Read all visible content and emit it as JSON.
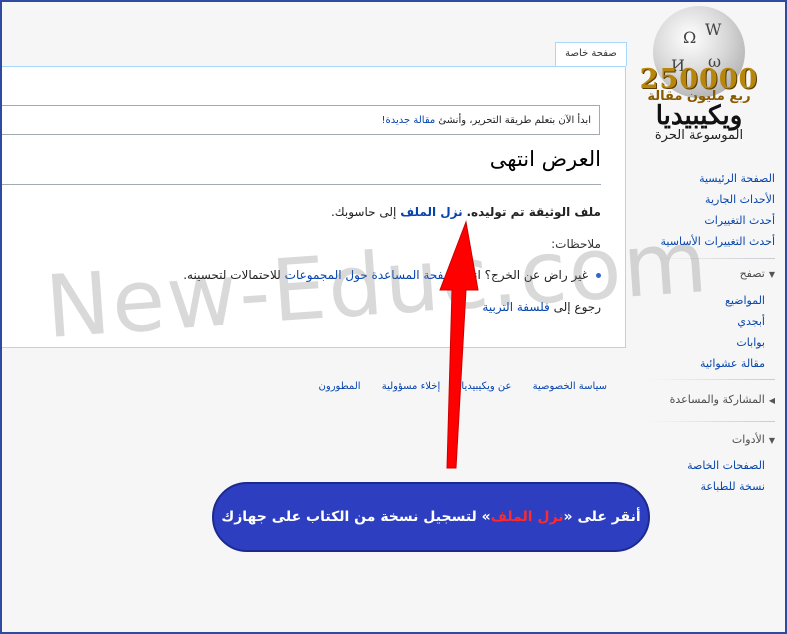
{
  "logo": {
    "count": "250000",
    "subtitle_count": "ربع مليون مقالة",
    "name": "ويكيبيديا",
    "tagline": "الموسوعة الحرة"
  },
  "sidebar": {
    "main_links": [
      "الصفحة الرئيسية",
      "الأحداث الجارية",
      "أحدث التغييرات",
      "أحدث التغييرات الأساسية"
    ],
    "browse": {
      "label": "تصفح",
      "items": [
        "المواضيع",
        "أبجدي",
        "بوابات",
        "مقالة عشوائية"
      ]
    },
    "participate": {
      "label": "المشاركة والمساعدة"
    },
    "tools": {
      "label": "الأدوات",
      "items": [
        "الصفحات الخاصة",
        "نسخة للطباعة"
      ]
    }
  },
  "tab": {
    "label": "صفحة خاصة"
  },
  "notice": {
    "text": "ابدأ الآن بتعلم طريقة التحرير، وأنشئ",
    "link": "مقالة جديدة!"
  },
  "page": {
    "title": "العرض انتهى",
    "generated_bold": "ملف الوثيقة تم توليده.",
    "download_link": "نزل الملف",
    "to_computer": "إلى حاسوبك.",
    "notes_label": "ملاحظات:",
    "bullet_pre": "غير راض عن الخرج؟ انظر",
    "bullet_link": "صفحة المساعدة حول المجموعات",
    "bullet_post": "للاحتمالات لتحسينه.",
    "back_pre": "رجوع إلى",
    "back_link": "فلسفة التربية"
  },
  "footer": {
    "links": [
      "سياسة الخصوصية",
      "عن ويكيبيديا",
      "إخلاء مسؤولية",
      "المطورون"
    ]
  },
  "watermark": "New-Educ.com",
  "callout": {
    "pre": "أنقر على «",
    "highlight": "نزل الملف",
    "post": "» لتسجيل نسخة من الكتاب على جهازك"
  },
  "colors": {
    "link": "#0645ad",
    "callout_bg": "#2d3fc0",
    "arrow": "#ff0000",
    "border": "#a7d7f9"
  }
}
